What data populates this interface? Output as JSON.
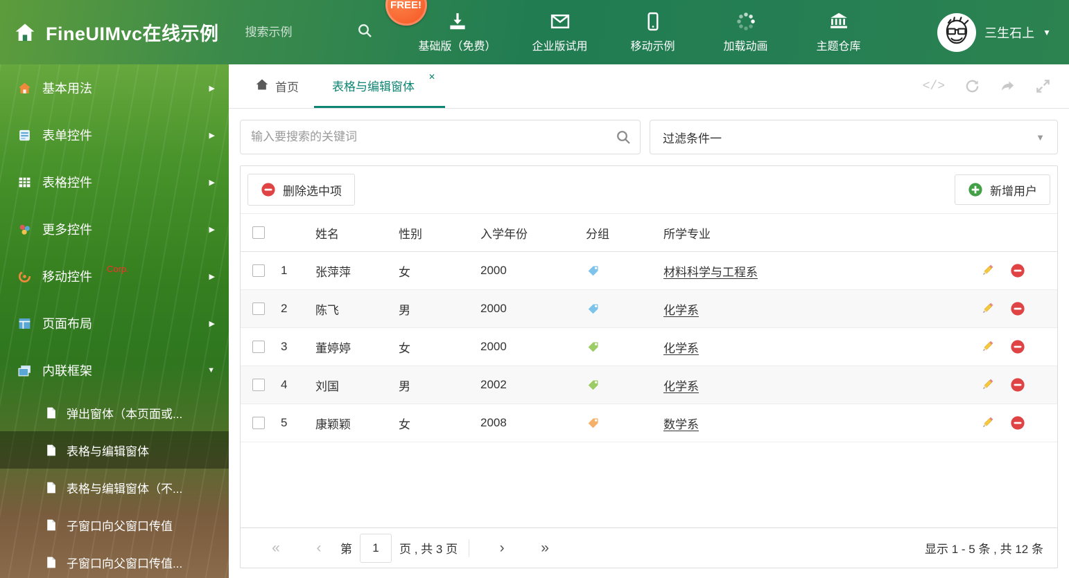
{
  "header": {
    "title": "FineUIMvc在线示例",
    "search_placeholder": "搜索示例",
    "free_badge": "FREE!",
    "nav": [
      {
        "label": "基础版（免费）"
      },
      {
        "label": "企业版试用"
      },
      {
        "label": "移动示例"
      },
      {
        "label": "加载动画"
      },
      {
        "label": "主题仓库"
      }
    ],
    "user": "三生石上"
  },
  "sidebar": {
    "items": [
      {
        "label": "基本用法"
      },
      {
        "label": "表单控件"
      },
      {
        "label": "表格控件"
      },
      {
        "label": "更多控件"
      },
      {
        "label": "移动控件",
        "badge": "Corp."
      },
      {
        "label": "页面布局"
      },
      {
        "label": "内联框架"
      }
    ],
    "subitems": [
      {
        "label": "弹出窗体（本页面或..."
      },
      {
        "label": "表格与编辑窗体"
      },
      {
        "label": "表格与编辑窗体（不..."
      },
      {
        "label": "子窗口向父窗口传值"
      },
      {
        "label": "子窗口向父窗口传值..."
      }
    ]
  },
  "tabs": {
    "home": "首页",
    "active": "表格与编辑窗体"
  },
  "filterbar": {
    "search_placeholder": "输入要搜索的关键词",
    "filter_selected": "过滤条件一"
  },
  "toolbar": {
    "delete": "删除选中项",
    "add": "新增用户"
  },
  "grid": {
    "headers": {
      "name": "姓名",
      "gender": "性别",
      "year": "入学年份",
      "group": "分组",
      "major": "所学专业"
    },
    "rows": [
      {
        "num": "1",
        "name": "张萍萍",
        "gender": "女",
        "year": "2000",
        "tag": "#7ec3ea",
        "major": "材料科学与工程系"
      },
      {
        "num": "2",
        "name": "陈飞",
        "gender": "男",
        "year": "2000",
        "tag": "#7ec3ea",
        "major": "化学系"
      },
      {
        "num": "3",
        "name": "董婷婷",
        "gender": "女",
        "year": "2000",
        "tag": "#9ccc65",
        "major": "化学系"
      },
      {
        "num": "4",
        "name": "刘国",
        "gender": "男",
        "year": "2002",
        "tag": "#9ccc65",
        "major": "化学系"
      },
      {
        "num": "5",
        "name": "康颖颖",
        "gender": "女",
        "year": "2008",
        "tag": "#f5b06a",
        "major": "数学系"
      }
    ]
  },
  "pagination": {
    "prefix": "第",
    "page": "1",
    "suffix": "页 , 共 3 页",
    "summary": "显示 1 - 5 条 , 共 12 条"
  },
  "icons": {
    "caret_down": "▼",
    "arrow_right": "▶",
    "arrow_down": "▼",
    "close": "✕",
    "code": "</>",
    "first": "«",
    "prev": "‹",
    "next": "›",
    "last": "»"
  },
  "colors": {
    "accent": "#0e8573",
    "danger": "#e04343",
    "success": "#43a047",
    "free_badge_bg": "#f4511e"
  }
}
